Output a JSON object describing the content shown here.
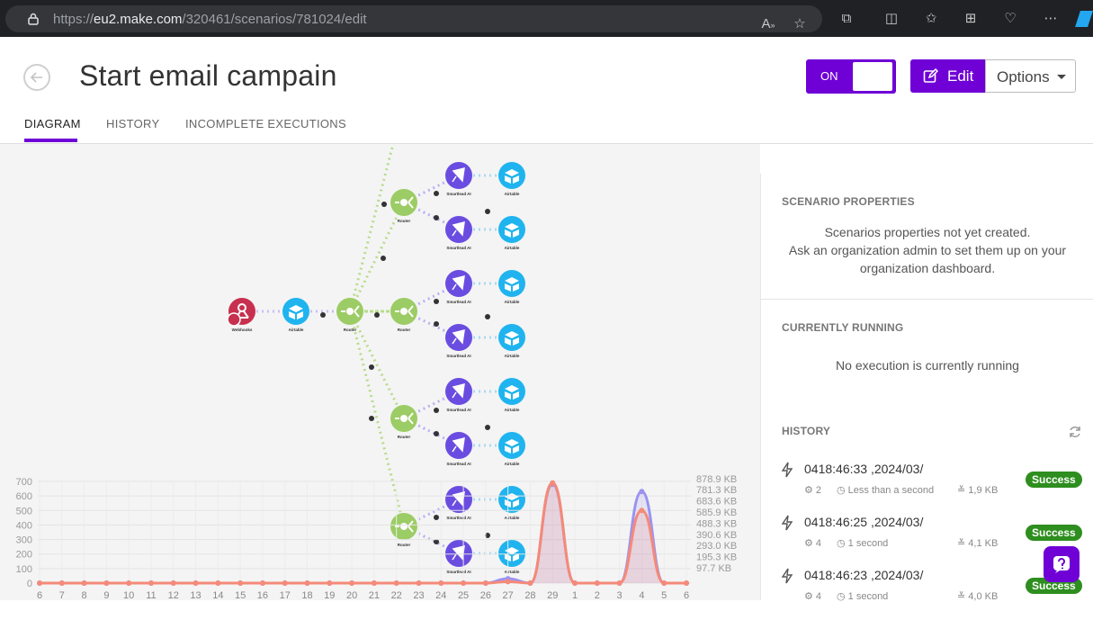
{
  "browser": {
    "url_prefix": "https://",
    "url_domain": "eu2.make.com",
    "url_path": "/320461/scenarios/781024/edit"
  },
  "header": {
    "title": "Start email campain",
    "toggle_label": "ON",
    "edit_label": "Edit",
    "options_label": "Options"
  },
  "tabs": [
    "DIAGRAM",
    "HISTORY",
    "INCOMPLETE EXECUTIONS"
  ],
  "modules": {
    "webhooks": {
      "name": "Webhooks"
    },
    "airtable": {
      "name": "Airtable"
    },
    "router": {
      "name": "Router"
    },
    "smartlead": {
      "name": "Smartlead AI"
    }
  },
  "sidebar": {
    "properties_title": "SCENARIO PROPERTIES",
    "properties_line1": "Scenarios properties not yet created.",
    "properties_line2": "Ask an organization admin to set them up on your",
    "properties_line3": "organization dashboard.",
    "running_title": "CURRENTLY RUNNING",
    "running_text": "No execution is currently running",
    "history_title": "HISTORY",
    "history": [
      {
        "time": "0418:46:33 ,2024/03/",
        "ops": "2",
        "duration": "Less than a second",
        "size": "1,9 KB",
        "status": "Success"
      },
      {
        "time": "0418:46:25 ,2024/03/",
        "ops": "4",
        "duration": "1 second",
        "size": "4,1 KB",
        "status": "Success"
      },
      {
        "time": "0418:46:23 ,2024/03/",
        "ops": "4",
        "duration": "1 second",
        "size": "4,0 KB",
        "status": "Success"
      }
    ]
  },
  "chart_data": {
    "type": "area",
    "categories": [
      "6",
      "7",
      "8",
      "9",
      "10",
      "11",
      "12",
      "13",
      "14",
      "15",
      "16",
      "17",
      "18",
      "19",
      "20",
      "21",
      "22",
      "23",
      "24",
      "25",
      "26",
      "27",
      "28",
      "29",
      "1",
      "2",
      "3",
      "4",
      "5",
      "6"
    ],
    "y_left_ticks": [
      "0",
      "100",
      "200",
      "300",
      "400",
      "500",
      "600",
      "700"
    ],
    "y_right_ticks": [
      "97.7 KB",
      "195.3 KB",
      "293.0 KB",
      "390.6 KB",
      "488.3 KB",
      "585.9 KB",
      "683.6 KB",
      "781.3 KB",
      "878.9 KB"
    ],
    "ylim": [
      0,
      700
    ],
    "series": [
      {
        "values": [
          0,
          0,
          0,
          0,
          0,
          0,
          0,
          0,
          0,
          0,
          0,
          0,
          0,
          0,
          0,
          0,
          0,
          0,
          0,
          0,
          0,
          30,
          0,
          680,
          0,
          0,
          0,
          630,
          0,
          0
        ],
        "color": "#9b93f0"
      },
      {
        "values": [
          0,
          0,
          0,
          0,
          0,
          0,
          0,
          0,
          0,
          0,
          0,
          0,
          0,
          0,
          0,
          0,
          0,
          0,
          0,
          0,
          0,
          10,
          0,
          690,
          0,
          0,
          0,
          500,
          0,
          0
        ],
        "color": "#f58a78"
      }
    ]
  },
  "colors": {
    "accent": "#6f00d6",
    "router": "#9ccc65",
    "airtable": "#1fb4ef",
    "smartlead": "#6a4de0",
    "webhooks": "#c8304f",
    "success": "#2e8e1f"
  }
}
